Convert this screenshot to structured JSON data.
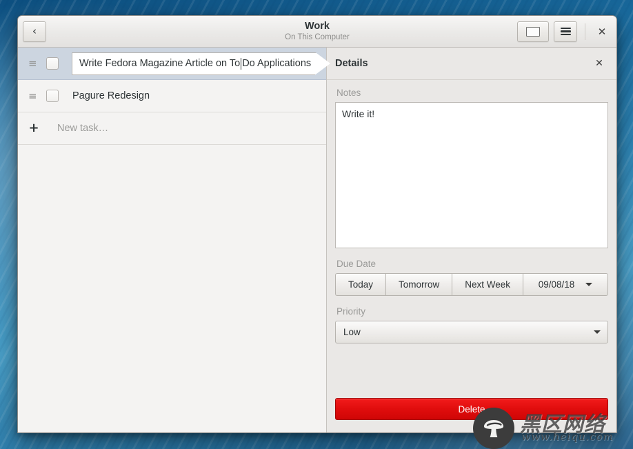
{
  "window": {
    "title": "Work",
    "subtitle": "On This Computer",
    "back_icon": "chevron-left-icon",
    "view_icon": "rectangle-view-icon",
    "menu_icon": "hamburger-menu-icon",
    "close_icon": "✕"
  },
  "tasklist": {
    "editing_row": {
      "grip_icon": "≡",
      "text_before_caret": "Write Fedora Magazine Article on To ",
      "text_after_caret": "Do Applications",
      "full_text": "Write Fedora Magazine Article on To Do Applications"
    },
    "rows": [
      {
        "grip_icon": "≡",
        "title": "Pagure Redesign",
        "checked": false
      }
    ],
    "new_task": {
      "plus_icon": "+",
      "label": "New task…"
    }
  },
  "details": {
    "title": "Details",
    "close_icon": "✕",
    "notes_label": "Notes",
    "notes_value": "Write it!",
    "due_date_label": "Due Date",
    "due_buttons": [
      "Today",
      "Tomorrow",
      "Next Week"
    ],
    "due_date_value": "09/08/18",
    "priority_label": "Priority",
    "priority_value": "Low",
    "delete_label": "Delete"
  },
  "watermark": {
    "cn_text": "黑区网络",
    "url_text": "www.heiqu.com"
  },
  "colors": {
    "selection": "#ccd5e0",
    "delete_red": "#e00d0d",
    "header_bg": "#ebeae8",
    "details_bg": "#eae8e6"
  }
}
